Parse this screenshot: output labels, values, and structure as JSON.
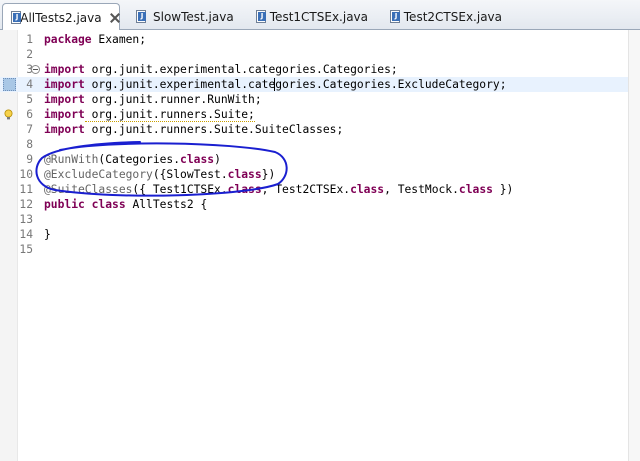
{
  "tabs": [
    {
      "label": "AllTests2.java",
      "active": true,
      "closable": true
    },
    {
      "label": "SlowTest.java",
      "active": false,
      "closable": false
    },
    {
      "label": "Test1CTSEx.java",
      "active": false,
      "closable": false
    },
    {
      "label": "Test2CTSEx.java",
      "active": false,
      "closable": false
    }
  ],
  "editor": {
    "current_line": 4,
    "lines": [
      {
        "num": "1",
        "segments": [
          {
            "t": "package",
            "k": "kw"
          },
          {
            "t": " Examen;",
            "k": "plain"
          }
        ]
      },
      {
        "num": "2",
        "segments": []
      },
      {
        "num": "3",
        "segments": [
          {
            "t": "import",
            "k": "kw"
          },
          {
            "t": " org.junit.experimental.categories.Categories;",
            "k": "plain"
          }
        ]
      },
      {
        "num": "4",
        "segments": [
          {
            "t": "import",
            "k": "kw"
          },
          {
            "t": " org.junit.experimental.categories.Categories.ExcludeCategory;",
            "k": "plain"
          }
        ]
      },
      {
        "num": "5",
        "segments": [
          {
            "t": "import",
            "k": "kw"
          },
          {
            "t": " org.junit.runner.RunWith;",
            "k": "plain"
          }
        ]
      },
      {
        "num": "6",
        "segments": [
          {
            "t": "import",
            "k": "kw"
          },
          {
            "t": " org.junit.runners.Suite;",
            "k": "plain"
          }
        ]
      },
      {
        "num": "7",
        "segments": [
          {
            "t": "import",
            "k": "kw"
          },
          {
            "t": " org.junit.runners.Suite.SuiteClasses;",
            "k": "plain"
          }
        ]
      },
      {
        "num": "8",
        "segments": []
      },
      {
        "num": "9",
        "segments": [
          {
            "t": "@RunWith",
            "k": "ann"
          },
          {
            "t": "(Categories.",
            "k": "plain"
          },
          {
            "t": "class",
            "k": "kw"
          },
          {
            "t": ")",
            "k": "plain"
          }
        ]
      },
      {
        "num": "10",
        "segments": [
          {
            "t": "@ExcludeCategory",
            "k": "ann"
          },
          {
            "t": "({SlowTest.",
            "k": "plain"
          },
          {
            "t": "class",
            "k": "kw"
          },
          {
            "t": "})",
            "k": "plain"
          }
        ]
      },
      {
        "num": "11",
        "segments": [
          {
            "t": "@SuiteClasses",
            "k": "ann"
          },
          {
            "t": "({ Test1CTSEx.",
            "k": "plain"
          },
          {
            "t": "class",
            "k": "kw"
          },
          {
            "t": ", Test2CTSEx.",
            "k": "plain"
          },
          {
            "t": "class",
            "k": "kw"
          },
          {
            "t": ", TestMock.",
            "k": "plain"
          },
          {
            "t": "class",
            "k": "kw"
          },
          {
            "t": " })",
            "k": "plain"
          }
        ]
      },
      {
        "num": "12",
        "segments": [
          {
            "t": "public",
            "k": "kw"
          },
          {
            "t": " ",
            "k": "plain"
          },
          {
            "t": "class",
            "k": "kw"
          },
          {
            "t": " AllTests2 {",
            "k": "plain"
          }
        ]
      },
      {
        "num": "13",
        "segments": []
      },
      {
        "num": "14",
        "segments": [
          {
            "t": "}",
            "k": "plain"
          }
        ]
      },
      {
        "num": "15",
        "segments": []
      }
    ]
  },
  "colors": {
    "keyword": "#7f0055",
    "annotation": "#646464",
    "line_number": "#787878",
    "current_line_bg": "#e8f2fe",
    "ink_circle": "#1a1fd0"
  }
}
